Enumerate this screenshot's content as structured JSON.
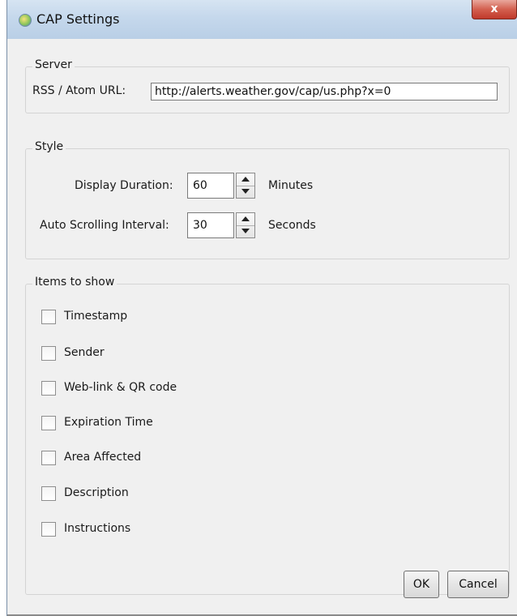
{
  "window": {
    "title": "CAP Settings",
    "close_glyph": "x",
    "app_icon": "app-globe-icon"
  },
  "server": {
    "group_label": "Server",
    "url_label": "RSS / Atom URL:",
    "url_value": "http://alerts.weather.gov/cap/us.php?x=0"
  },
  "style": {
    "group_label": "Style",
    "display_duration": {
      "label": "Display Duration:",
      "value": "60",
      "unit": "Minutes"
    },
    "auto_scroll": {
      "label": "Auto Scrolling Interval:",
      "value": "30",
      "unit": "Seconds"
    }
  },
  "items": {
    "group_label": "Items to show",
    "list": [
      {
        "label": "Timestamp",
        "checked": false
      },
      {
        "label": "Sender",
        "checked": false
      },
      {
        "label": "Web-link & QR code",
        "checked": false
      },
      {
        "label": "Expiration Time",
        "checked": false
      },
      {
        "label": "Area Affected",
        "checked": false
      },
      {
        "label": "Description",
        "checked": false
      },
      {
        "label": "Instructions",
        "checked": false
      }
    ]
  },
  "buttons": {
    "ok": "OK",
    "cancel": "Cancel"
  }
}
